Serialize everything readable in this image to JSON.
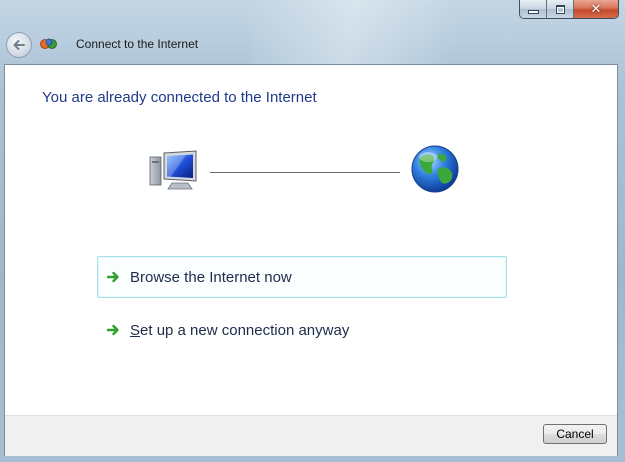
{
  "window": {
    "title": "Connect to the Internet",
    "caption_buttons": [
      "minimize",
      "maximize",
      "close"
    ]
  },
  "nav": {
    "back_icon": "back-arrow-icon",
    "app_icon": "network-connect-icon"
  },
  "main": {
    "heading": "You are already connected to the Internet",
    "diagram": {
      "left_icon": "computer-icon",
      "right_icon": "globe-icon"
    },
    "options": [
      {
        "label": "Browse the Internet now",
        "icon": "green-arrow-icon"
      },
      {
        "label_accel": "S",
        "label_rest": "et up a new connection anyway",
        "icon": "green-arrow-icon"
      }
    ]
  },
  "footer": {
    "cancel_label": "Cancel"
  },
  "colors": {
    "heading": "#1e3a8a",
    "accent_arrow": "#2ea12e",
    "highlight_border": "#a8e0ea"
  }
}
